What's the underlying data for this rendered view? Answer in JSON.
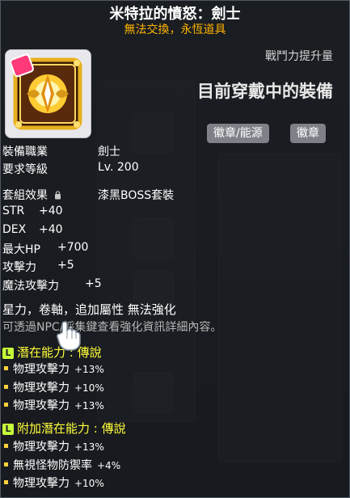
{
  "item": {
    "name": "米特拉的憤怒：劍士",
    "trade_note": "無法交換，永恆道具"
  },
  "header": {
    "power_label": "戰鬥力提升量",
    "equipped_label": "目前穿戴中的裝備",
    "chips": [
      "徽章/能源",
      "徽章"
    ]
  },
  "stats": {
    "job_label": "裝備職業",
    "job_value": "劍士",
    "level_label": "要求等級",
    "level_value": "Lv. 200",
    "set_label": "套組效果",
    "set_value": "漆黑BOSS套裝",
    "lines": [
      {
        "label": "STR",
        "value": "+40"
      },
      {
        "label": "DEX",
        "value": "+40"
      },
      {
        "label": "最大HP",
        "value": "+700"
      },
      {
        "label": "攻擊力",
        "value": "+5"
      },
      {
        "label": "魔法攻擊力",
        "value": "+5"
      }
    ]
  },
  "notes": {
    "restriction": "星力，卷軸，追加屬性 無法強化",
    "hint": "可透過NPC/採集鍵查看強化資訊詳細內容。"
  },
  "potential": {
    "badge": "L",
    "title": "潛在能力 : 傳說",
    "lines": [
      {
        "label": "物理攻擊力",
        "value": "+13%"
      },
      {
        "label": "物理攻擊力",
        "value": "+10%"
      },
      {
        "label": "物理攻擊力",
        "value": "+13%"
      }
    ]
  },
  "additional_potential": {
    "badge": "L",
    "title": "附加潛在能力 : 傳說",
    "lines": [
      {
        "label": "物理攻擊力",
        "value": "+13%"
      },
      {
        "label": "無視怪物防禦率",
        "value": "+4%"
      },
      {
        "label": "物理攻擊力",
        "value": "+10%"
      }
    ]
  },
  "colors": {
    "title": "#ffffff",
    "trade_note": "#ffb400",
    "potential_header": "#ffff3a",
    "badge": "#c6ff3a",
    "bullet": "#ffd23a"
  },
  "icons": {
    "item_icon": "golden-emblem-icon",
    "set_lock": "lock-icon",
    "cursor": "white-glove-cursor-icon"
  }
}
